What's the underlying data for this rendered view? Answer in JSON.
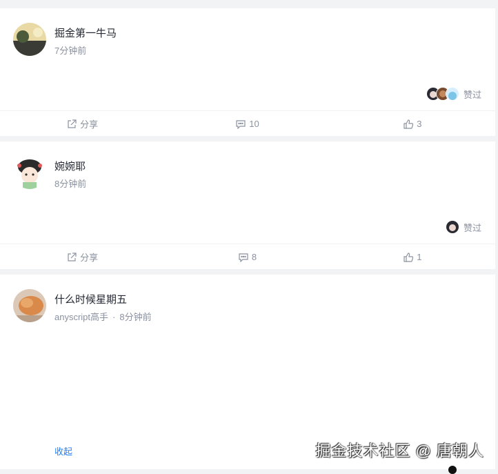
{
  "posts": [
    {
      "author": "掘金第一牛马",
      "meta": "7分钟前",
      "liked_label": "赞过",
      "actions": {
        "share": "分享",
        "comments": "10",
        "likes": "3"
      }
    },
    {
      "author": "婉婉耶",
      "meta": "8分钟前",
      "liked_label": "赞过",
      "actions": {
        "share": "分享",
        "comments": "8",
        "likes": "1"
      }
    },
    {
      "author": "什么时候星期五",
      "title_badge": "anyscript高手",
      "meta": "8分钟前",
      "collapse_label": "收起"
    }
  ],
  "watermark": "掘金技术社区 @ 唐朝人",
  "colors": {
    "background": "#f2f3f5",
    "card": "#ffffff",
    "text_primary": "#252933",
    "text_secondary": "#8a919f",
    "link": "#1e80ff"
  },
  "icons": [
    "share-icon",
    "comment-icon",
    "like-icon"
  ]
}
